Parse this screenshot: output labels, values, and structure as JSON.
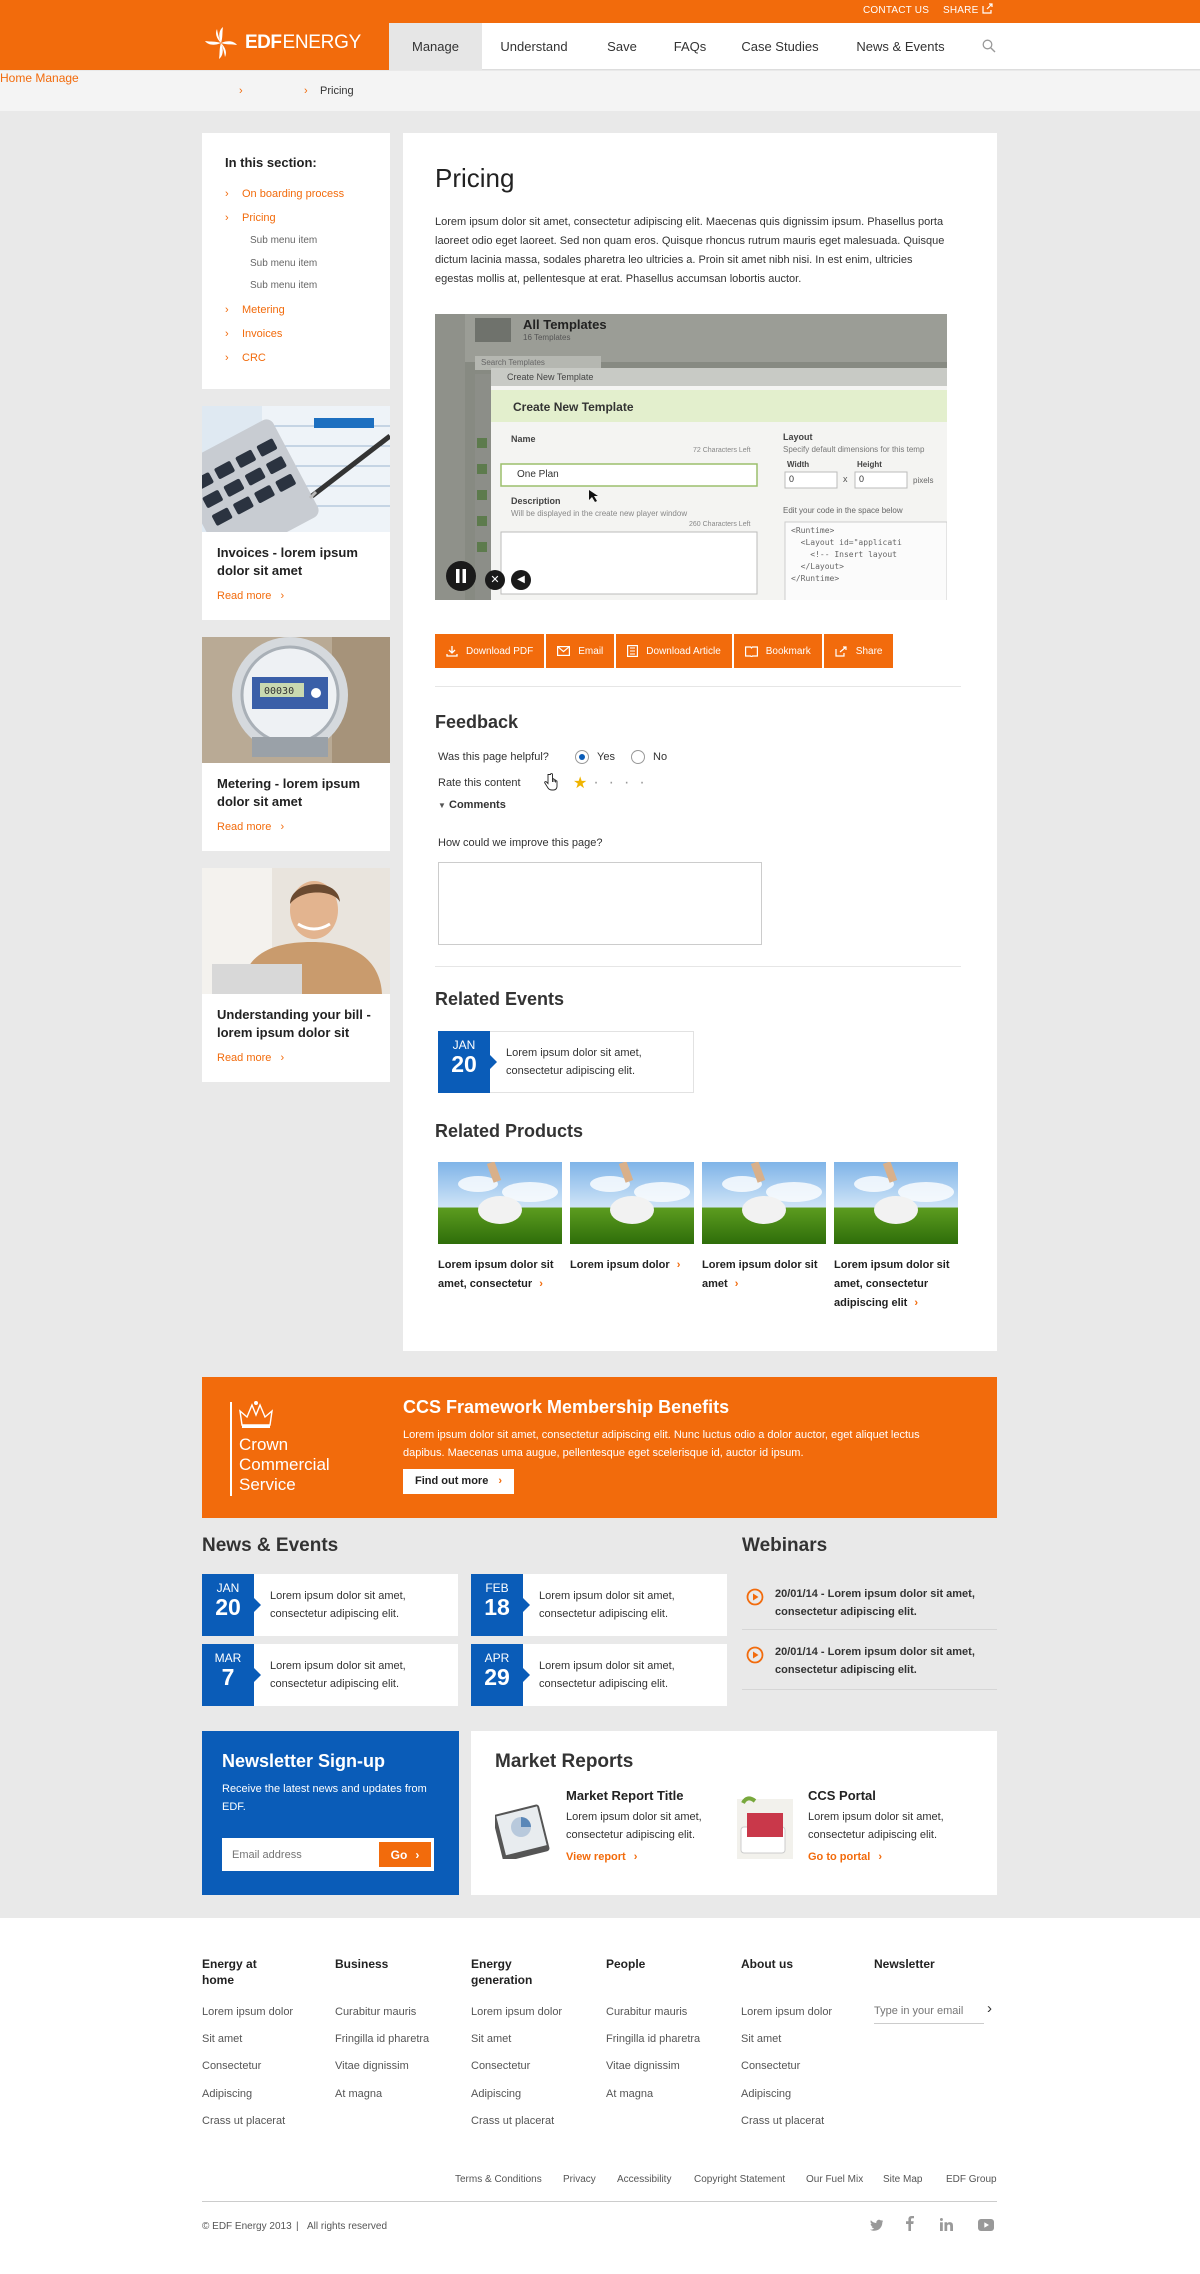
{
  "topbar": {
    "contact": "CONTACT US",
    "share": "SHARE"
  },
  "logo": {
    "bold": "EDF",
    "light": "ENERGY"
  },
  "nav": [
    "Manage",
    "Understand",
    "Save",
    "FAQs",
    "Case Studies",
    "News & Events"
  ],
  "breadcrumb": {
    "home": "Home",
    "manage": "Manage",
    "current": "Pricing"
  },
  "sidebar": {
    "heading": "In this section:",
    "items": [
      "On boarding process",
      "Pricing",
      "Metering",
      "Invoices",
      "CRC"
    ],
    "subitems": [
      "Sub menu item",
      "Sub menu item",
      "Sub menu item"
    ]
  },
  "promos": [
    {
      "title": "Invoices - lorem ipsum dolor sit amet",
      "link": "Read more"
    },
    {
      "title": "Metering - lorem ipsum dolor sit amet",
      "link": "Read more"
    },
    {
      "title": "Understanding your bill - lorem ipsum dolor sit",
      "link": "Read more"
    }
  ],
  "page": {
    "title": "Pricing",
    "intro": "Lorem ipsum dolor sit amet, consectetur adipiscing elit. Maecenas quis dignissim ipsum. Phasellus porta laoreet odio eget laoreet. Sed non quam eros. Quisque rhoncus rutrum mauris eget malesuada. Quisque dictum lacinia massa, sodales pharetra leo ultricies a. Proin sit amet nibh nisi. In est enim, ultricies egestas mollis at, pellentesque at erat. Phasellus accumsan lobortis auctor."
  },
  "video": {
    "header": "All Templates",
    "subheader": "16 Templates",
    "search": "Search Templates",
    "dialog_bar": "Create New Template",
    "dialog_title": "Create New Template",
    "name_label": "Name",
    "name_hint": "72 Characters Left",
    "name_value": "One Plan",
    "desc_label": "Description",
    "desc_hint": "Will be displayed in the create new player window",
    "desc_left": "260 Characters Left",
    "layout_label": "Layout",
    "layout_hint": "Specify default dimensions for this temp",
    "width_label": "Width",
    "height_label": "Height",
    "width_value": "0",
    "height_value": "0",
    "x": "x",
    "pixels": "pixels",
    "code_hint": "Edit your code in the space below",
    "code": [
      "<Runtime>",
      "  <Layout id=\"applicati",
      "    <!-- Insert layout",
      "  </Layout>",
      "</Runtime>"
    ]
  },
  "actions": [
    "Download PDF",
    "Email",
    "Download Article",
    "Bookmark",
    "Share"
  ],
  "feedback": {
    "heading": "Feedback",
    "helpful": "Was this page helpful?",
    "yes": "Yes",
    "no": "No",
    "rate": "Rate this content",
    "rating": 1,
    "rating_max": 5,
    "comments": "Comments",
    "improve": "How could we improve this page?"
  },
  "related_events": {
    "heading": "Related Events",
    "items": [
      {
        "month": "JAN",
        "day": "20",
        "text": "Lorem ipsum dolor sit amet, consectetur adipiscing elit."
      }
    ]
  },
  "related_products": {
    "heading": "Related Products",
    "items": [
      "Lorem ipsum dolor sit amet, consectetur",
      "Lorem ipsum dolor",
      "Lorem ipsum dolor sit amet",
      "Lorem ipsum dolor sit amet, consectetur adipiscing elit"
    ]
  },
  "ccs": {
    "logo": [
      "Crown",
      "Commercial",
      "Service"
    ],
    "title": "CCS Framework Membership Benefits",
    "text": "Lorem ipsum dolor sit amet, consectetur adipiscing elit. Nunc luctus odio a dolor auctor, eget aliquet lectus dapibus. Maecenas uma augue, pellentesque eget scelerisque id, auctor id ipsum.",
    "button": "Find out more"
  },
  "news": {
    "heading": "News & Events",
    "items": [
      {
        "month": "JAN",
        "day": "20",
        "text": "Lorem ipsum dolor sit amet, consectetur adipiscing elit."
      },
      {
        "month": "FEB",
        "day": "18",
        "text": "Lorem ipsum dolor sit amet, consectetur adipiscing elit."
      },
      {
        "month": "MAR",
        "day": "7",
        "text": "Lorem ipsum dolor sit amet, consectetur adipiscing elit."
      },
      {
        "month": "APR",
        "day": "29",
        "text": "Lorem ipsum dolor sit amet, consectetur adipiscing elit."
      }
    ]
  },
  "webinars": {
    "heading": "Webinars",
    "items": [
      "20/01/14 - Lorem ipsum dolor sit amet, consectetur adipiscing elit.",
      "20/01/14 - Lorem ipsum dolor sit amet, consectetur adipiscing elit."
    ]
  },
  "newsletter": {
    "title": "Newsletter Sign-up",
    "text": "Receive the latest news and updates from EDF.",
    "placeholder": "Email address",
    "button": "Go"
  },
  "market": {
    "heading": "Market Reports",
    "items": [
      {
        "title": "Market Report Title",
        "text": "Lorem ipsum dolor sit amet, consectetur adipiscing elit.",
        "link": "View report"
      },
      {
        "title": "CCS Portal",
        "text": "Lorem ipsum dolor sit amet, consectetur adipiscing elit.",
        "link": "Go to portal"
      }
    ]
  },
  "footer": {
    "columns": [
      {
        "heading": "Energy at home",
        "items": [
          "Lorem ipsum dolor",
          "Sit amet",
          "Consectetur",
          "Adipiscing",
          "Crass ut placerat"
        ]
      },
      {
        "heading": "Business",
        "items": [
          "Curabitur mauris",
          "Fringilla id pharetra",
          "Vitae dignissim",
          "At magna"
        ]
      },
      {
        "heading": "Energy generation",
        "items": [
          "Lorem ipsum dolor",
          "Sit amet",
          "Consectetur",
          "Adipiscing",
          "Crass ut placerat"
        ]
      },
      {
        "heading": "People",
        "items": [
          "Curabitur mauris",
          "Fringilla id pharetra",
          "Vitae dignissim",
          "At magna"
        ]
      },
      {
        "heading": "About us",
        "items": [
          "Lorem ipsum dolor",
          "Sit amet",
          "Consectetur",
          "Adipiscing",
          "Crass ut placerat"
        ]
      }
    ],
    "newsletter_heading": "Newsletter",
    "newsletter_placeholder": "Type in your email",
    "bottom_links": [
      "Terms & Conditions",
      "Privacy",
      "Accessibility",
      "Copyright Statement",
      "Our Fuel Mix",
      "Site Map",
      "EDF Group"
    ],
    "copyright": "© EDF Energy 2013",
    "rights": "All rights reserved"
  },
  "colors": {
    "brand": "#f26b0c",
    "blue": "#0a5cb8"
  }
}
